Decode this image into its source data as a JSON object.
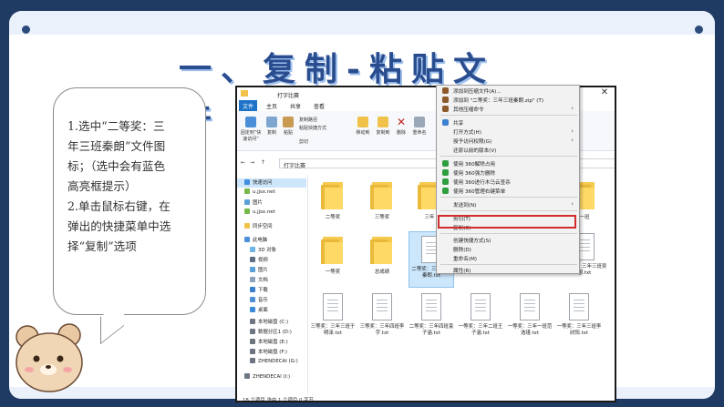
{
  "slide": {
    "title": "一、复制-粘贴文件",
    "bubble_lines": [
      "1.选中“二等奖：三",
      "年三班秦朗”文件图",
      "标；（选中会有蓝色",
      "高亮框提示）",
      "2.单击鼠标右键，在",
      "弹出的快捷菜单中选",
      "择“复制”选项"
    ]
  },
  "explorer": {
    "title": "打字比赛",
    "tabs": [
      "文件",
      "主页",
      "共享",
      "查看"
    ],
    "ribbon": {
      "pin_label": "固定到“快速访问”",
      "copy_label": "复制",
      "paste_label": "粘贴",
      "copy_path_label": "复制路径",
      "paste_shortcut_label": "粘贴快捷方式",
      "cut_label": "剪切",
      "move_to_label": "移动到",
      "copy_to_label": "复制到",
      "delete_label": "删除",
      "rename_label": "重命名"
    },
    "address": "打字比赛",
    "nav": [
      {
        "label": "快速访问",
        "selected": true
      },
      {
        "label": "u.jjsx.net",
        "selected": false
      },
      {
        "label": "图片",
        "selected": false
      },
      {
        "label": "u.jjsx.net",
        "selected": false
      },
      {
        "label": "同步空间",
        "selected": false
      },
      {
        "label": "此电脑",
        "selected": false
      },
      {
        "label": "3D 对象",
        "selected": false
      },
      {
        "label": "视频",
        "selected": false
      },
      {
        "label": "图片",
        "selected": false
      },
      {
        "label": "文档",
        "selected": false
      },
      {
        "label": "下载",
        "selected": false
      },
      {
        "label": "音乐",
        "selected": false
      },
      {
        "label": "桌面",
        "selected": false
      },
      {
        "label": "本地磁盘 (C:)",
        "selected": false
      },
      {
        "label": "数据分区1 (D:)",
        "selected": false
      },
      {
        "label": "本地磁盘 (E:)",
        "selected": false
      },
      {
        "label": "本地磁盘 (F:)",
        "selected": false
      },
      {
        "label": "ZHENDECAI (G:)",
        "selected": false
      },
      {
        "label": "ZHENDECAI (I:)",
        "selected": false
      }
    ],
    "files_row1": [
      "二等奖",
      "三等奖",
      "三年",
      "一班"
    ],
    "files_row2": [
      "一等奖",
      "总成绩",
      "二等奖：三年三班秦朗.txt",
      "",
      "",
      "三等奖：三年三班吴想.txt"
    ],
    "files_row3": [
      "三等奖：三年三班于明泽.txt",
      "三等奖：三年四班李宇.txt",
      "二等奖：三年四班袁子涵.txt",
      "一等奖：三年二班王子涵.txt",
      "一等奖：三年一班范浩瑾.txt",
      "一等奖：三年三班李欣阳.txt"
    ],
    "status": "18 个项目    选中 1 个项目  0 字节"
  },
  "context_menu": {
    "items": [
      "添加到压缩文件(A)...",
      "添加到 \"二等奖：三年三班秦朗.zip\" (T)",
      "其他压缩命令",
      "共享",
      "打开方式(H)",
      "授予访问权限(G)",
      "还原以前的版本(V)",
      "使用 360解除占用",
      "使用 360强力删除",
      "使用 360进行木马云查杀",
      "使用 360管理右键菜单",
      "发送到(N)",
      "剪切(T)",
      "复制(C)",
      "创建快捷方式(S)",
      "删除(D)",
      "重命名(M)",
      "属性(R)"
    ],
    "highlighted": "复制(C)"
  },
  "colors": {
    "frame": "#1f3a63",
    "title": "#2a4d8f",
    "accent": "#1e73c8",
    "highlight_border": "#d12b2b"
  }
}
